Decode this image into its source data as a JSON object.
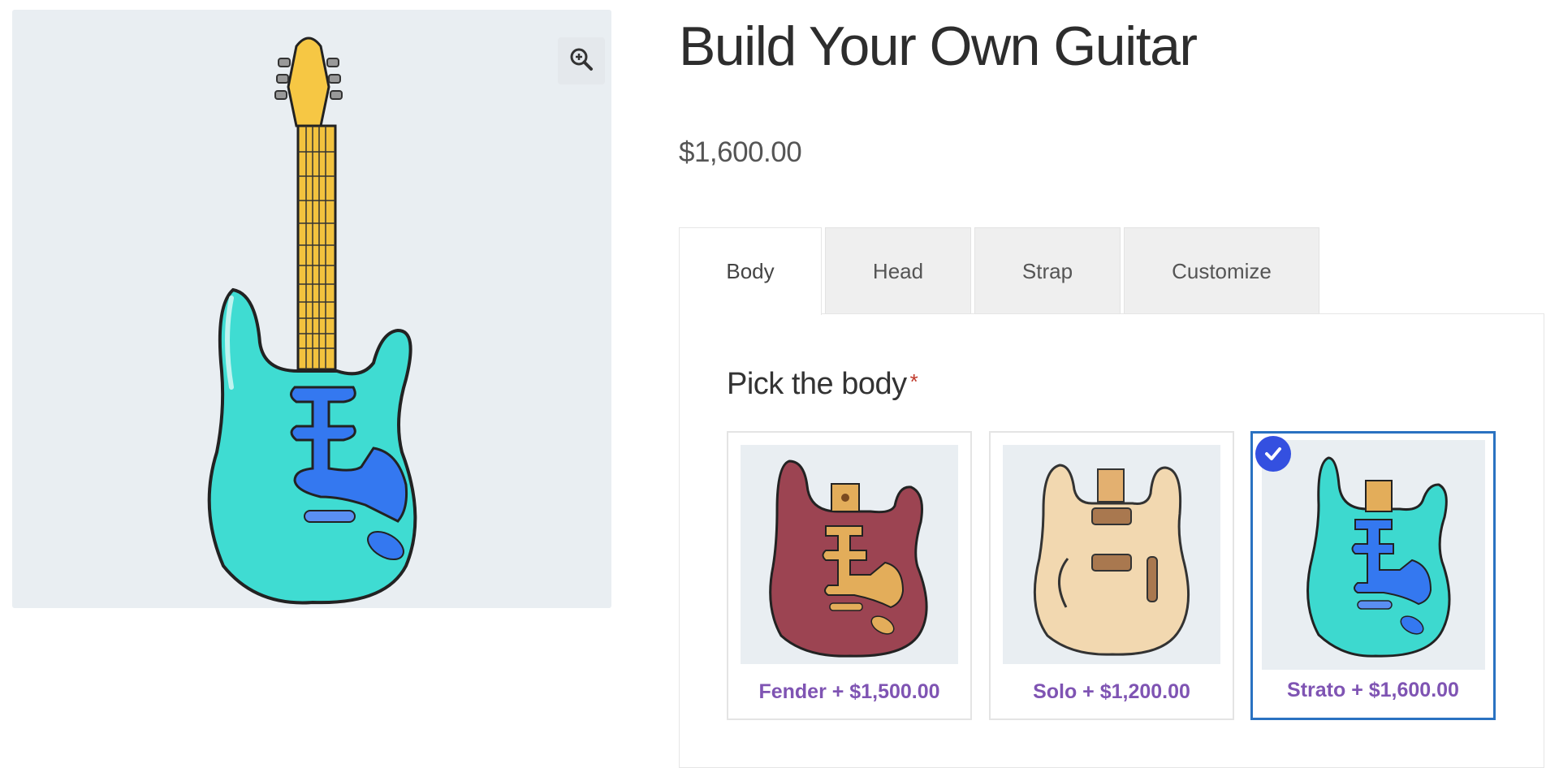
{
  "product": {
    "title": "Build Your Own Guitar",
    "price": "$1,600.00"
  },
  "gallery": {
    "zoom_icon": "zoom-in-icon"
  },
  "tabs": [
    {
      "label": "Body",
      "active": true
    },
    {
      "label": "Head",
      "active": false
    },
    {
      "label": "Strap",
      "active": false
    },
    {
      "label": "Customize",
      "active": false
    }
  ],
  "body_section": {
    "title": "Pick the body",
    "required_marker": "*",
    "options": [
      {
        "label": "Fender + $1,500.00",
        "selected": false,
        "color": "#9c4452"
      },
      {
        "label": "Solo + $1,200.00",
        "selected": false,
        "color": "#f2d8b0"
      },
      {
        "label": "Strato + $1,600.00",
        "selected": true,
        "color": "#3dd9cf"
      }
    ]
  },
  "colors": {
    "accent": "#7f54b3",
    "selected_border": "#2a72c1",
    "check_badge": "#3450e0"
  }
}
